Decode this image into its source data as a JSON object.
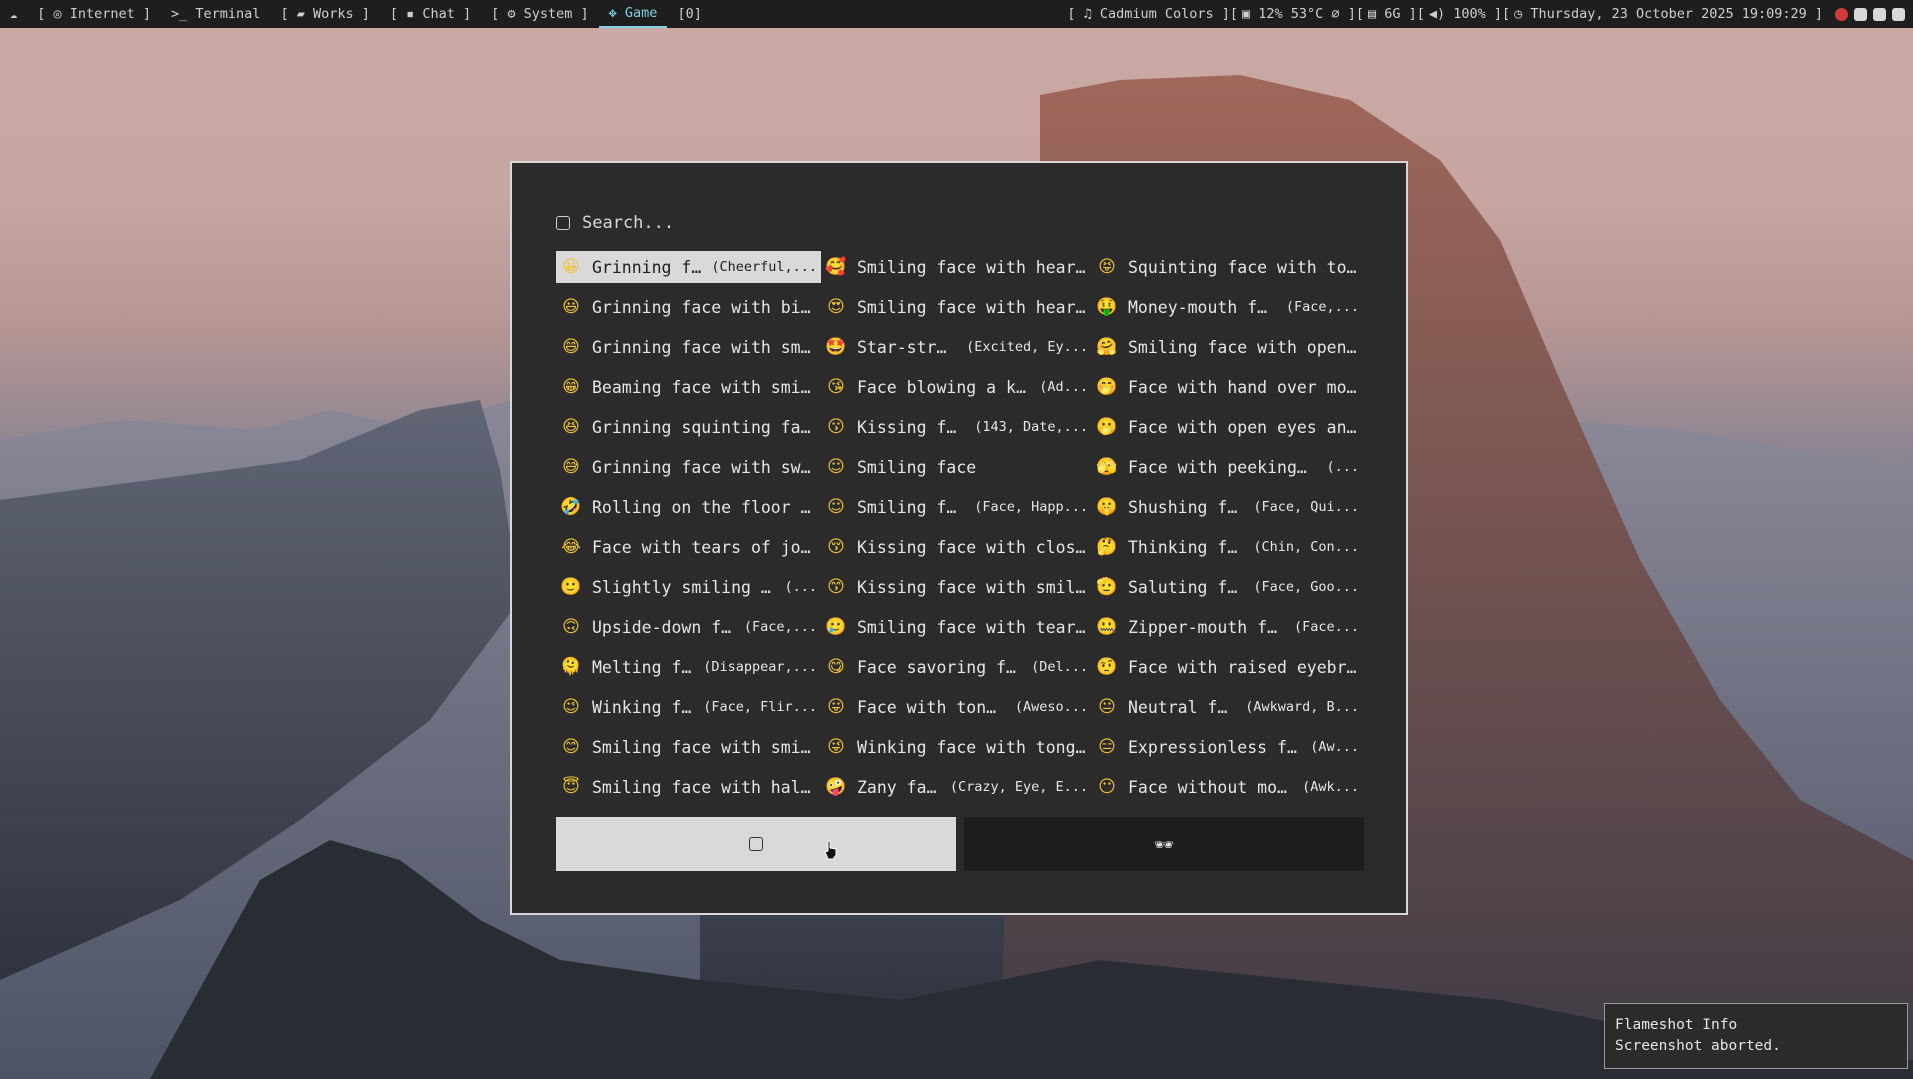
{
  "topbar": {
    "workspaces": [
      {
        "icon": "cloud-icon",
        "glyph": "☁",
        "label": ""
      },
      {
        "icon": "globe-icon",
        "glyph": "◎",
        "label": "[ ◎ Internet ]"
      },
      {
        "icon": "terminal-icon",
        "glyph": ">_",
        "label": ">_ Terminal"
      },
      {
        "icon": "folder-icon",
        "glyph": "",
        "label": "[ ▰ Works ]"
      },
      {
        "icon": "chat-icon",
        "glyph": "",
        "label": "[ ▪ Chat ]"
      },
      {
        "icon": "gear-icon",
        "glyph": "",
        "label": "[ ⚙ System ]"
      },
      {
        "icon": "gamepad-icon",
        "glyph": "",
        "label": "✥ Game"
      },
      {
        "icon": "",
        "glyph": "",
        "label": "[0]"
      }
    ],
    "status": {
      "music": "[ ♫ Cadmium Colors ][",
      "cpu": "▣ 12% 53°C ⌀ ][",
      "mem": "▤ 6G ][",
      "volume": "◀) 100% ][",
      "clock": "◷ Thursday, 23 October 2025 19:09:29 ]"
    }
  },
  "launcher": {
    "search_placeholder": "Search...",
    "items": [
      {
        "emoji": "😀",
        "name": "Grinning face",
        "kw": "(Cheerful,..."
      },
      {
        "emoji": "🥰",
        "name": "Smiling face with hear...",
        "kw": ""
      },
      {
        "emoji": "😝",
        "name": "Squinting face with to...",
        "kw": ""
      },
      {
        "emoji": "😃",
        "name": "Grinning face with big...",
        "kw": ""
      },
      {
        "emoji": "😍",
        "name": "Smiling face with hear...",
        "kw": ""
      },
      {
        "emoji": "🤑",
        "name": "Money-mouth face",
        "kw": "(Face,..."
      },
      {
        "emoji": "😄",
        "name": "Grinning face with smi...",
        "kw": ""
      },
      {
        "emoji": "🤩",
        "name": "Star-struck",
        "kw": "(Excited, Ey..."
      },
      {
        "emoji": "🤗",
        "name": "Smiling face with open...",
        "kw": ""
      },
      {
        "emoji": "😁",
        "name": "Beaming face with smil...",
        "kw": ""
      },
      {
        "emoji": "😘",
        "name": "Face blowing a kiss",
        "kw": "(Ad..."
      },
      {
        "emoji": "🤭",
        "name": "Face with hand over mo...",
        "kw": ""
      },
      {
        "emoji": "😆",
        "name": "Grinning squinting fac...",
        "kw": ""
      },
      {
        "emoji": "😗",
        "name": "Kissing face",
        "kw": "(143, Date,..."
      },
      {
        "emoji": "🫢",
        "name": "Face with open eyes an...",
        "kw": ""
      },
      {
        "emoji": "😅",
        "name": "Grinning face with swe...",
        "kw": ""
      },
      {
        "emoji": "☺",
        "name": "Smiling face",
        "kw": ""
      },
      {
        "emoji": "🫣",
        "name": "Face with peeking eye",
        "kw": "(..."
      },
      {
        "emoji": "🤣",
        "name": "Rolling on the floor l...",
        "kw": ""
      },
      {
        "emoji": "☺",
        "name": "Smiling face",
        "kw": "(Face, Happ..."
      },
      {
        "emoji": "🤫",
        "name": "Shushing face",
        "kw": "(Face, Qui..."
      },
      {
        "emoji": "😂",
        "name": "Face with tears of joy...",
        "kw": ""
      },
      {
        "emoji": "😚",
        "name": "Kissing face with clos...",
        "kw": ""
      },
      {
        "emoji": "🤔",
        "name": "Thinking face",
        "kw": "(Chin, Con..."
      },
      {
        "emoji": "🙂",
        "name": "Slightly smiling face",
        "kw": "(..."
      },
      {
        "emoji": "😙",
        "name": "Kissing face with smil...",
        "kw": ""
      },
      {
        "emoji": "🫡",
        "name": "Saluting face",
        "kw": "(Face, Goo..."
      },
      {
        "emoji": "🙃",
        "name": "Upside-down face",
        "kw": "(Face,..."
      },
      {
        "emoji": "🥲",
        "name": "Smiling face with tear...",
        "kw": ""
      },
      {
        "emoji": "🤐",
        "name": "Zipper-mouth face",
        "kw": "(Face..."
      },
      {
        "emoji": "🫠",
        "name": "Melting face",
        "kw": "(Disappear,..."
      },
      {
        "emoji": "😋",
        "name": "Face savoring food",
        "kw": "(Del..."
      },
      {
        "emoji": "🤨",
        "name": "Face with raised eyebr...",
        "kw": ""
      },
      {
        "emoji": "😉",
        "name": "Winking face",
        "kw": "(Face, Flir..."
      },
      {
        "emoji": "😛",
        "name": "Face with tongue",
        "kw": "(Aweso..."
      },
      {
        "emoji": "😐",
        "name": "Neutral face",
        "kw": "(Awkward, B..."
      },
      {
        "emoji": "😊",
        "name": "Smiling face with smil...",
        "kw": ""
      },
      {
        "emoji": "😜",
        "name": "Winking face with tong...",
        "kw": ""
      },
      {
        "emoji": "😑",
        "name": "Expressionless face",
        "kw": "(Aw..."
      },
      {
        "emoji": "😇",
        "name": "Smiling face with halo...",
        "kw": ""
      },
      {
        "emoji": "🤪",
        "name": "Zany face",
        "kw": "(Crazy, Eye, E..."
      },
      {
        "emoji": "😶",
        "name": "Face without mouth",
        "kw": "(Awk..."
      }
    ],
    "tabs": [
      {
        "icon": "emoji-sticker-icon",
        "glyph": "",
        "active": true
      },
      {
        "icon": "sunglasses-icon",
        "glyph": "🕶",
        "active": false
      }
    ]
  },
  "toast": {
    "title": "Flameshot Info",
    "message": "Screenshot aborted."
  },
  "colors": {
    "accent": "#7fd0e0",
    "panel": "#2b2b2b",
    "selected": "#d9d9d9"
  }
}
